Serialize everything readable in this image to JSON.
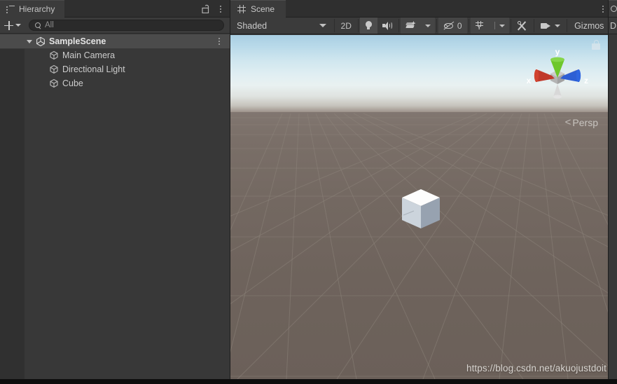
{
  "hierarchy": {
    "tab": {
      "label": "Hierarchy",
      "icon": "hierarchy-list-icon"
    },
    "lock_icon": "lock-open-icon",
    "menu_icon": "kebab-menu-icon",
    "toolbar": {
      "add_label": "+",
      "add_icon": "plus-icon",
      "add_dropdown_icon": "chevron-down-icon",
      "search_placeholder": "All",
      "search_value": "",
      "search_icon": "search-icon"
    },
    "tree": [
      {
        "name": "SampleScene",
        "icon": "unity-scene-icon",
        "depth": 0,
        "expanded": true,
        "selected": true,
        "has_menu": true
      },
      {
        "name": "Main Camera",
        "icon": "gameobject-cube-icon",
        "depth": 1,
        "expanded": false,
        "selected": false,
        "has_menu": false
      },
      {
        "name": "Directional Light",
        "icon": "gameobject-cube-icon",
        "depth": 1,
        "expanded": false,
        "selected": false,
        "has_menu": false
      },
      {
        "name": "Cube",
        "icon": "gameobject-cube-icon",
        "depth": 1,
        "expanded": false,
        "selected": false,
        "has_menu": false
      }
    ]
  },
  "scene": {
    "tab": {
      "label": "Scene",
      "icon": "scene-grid-icon"
    },
    "menu_icon": "kebab-menu-icon",
    "toolbar": {
      "draw_mode": "Shaded",
      "draw_mode_arrow_icon": "chevron-down-icon",
      "toggle_2d": "2D",
      "lighting_icon": "lightbulb-icon",
      "audio_icon": "speaker-icon",
      "fx_icon": "effects-stack-icon",
      "fx_arrow_icon": "chevron-down-icon",
      "hidden_count": "0",
      "hidden_icon": "eye-off-icon",
      "grid_icon": "grid-visibility-icon",
      "grid_arrow_icon": "chevron-down-icon",
      "tools_icon": "scene-tools-icon",
      "camera_icon": "scene-camera-icon",
      "camera_arrow_icon": "chevron-down-icon",
      "gizmos_label": "Gizmos"
    },
    "viewport": {
      "projection_label": "Persp",
      "projection_arrow_icon": "left-arrow-icon",
      "gizmo": {
        "axis_x": "x",
        "axis_y": "y",
        "axis_z": "z",
        "color_x": "#c0392b",
        "color_y": "#6ec72b",
        "color_z": "#2d5fd4",
        "lock_icon": "lock-closed-icon"
      },
      "objects": [
        {
          "name": "Cube",
          "type": "cube-mesh"
        }
      ],
      "watermark": "https://blog.csdn.net/akuojustdoit",
      "sky_top_color": "#a8cee2",
      "horizon_color": "#e9f1f1",
      "ground_color": "#6f645d",
      "grid_color": "#8e857c"
    }
  },
  "right_panel": {
    "tab_icon": "inspector-icon",
    "label_fragment": "D"
  }
}
